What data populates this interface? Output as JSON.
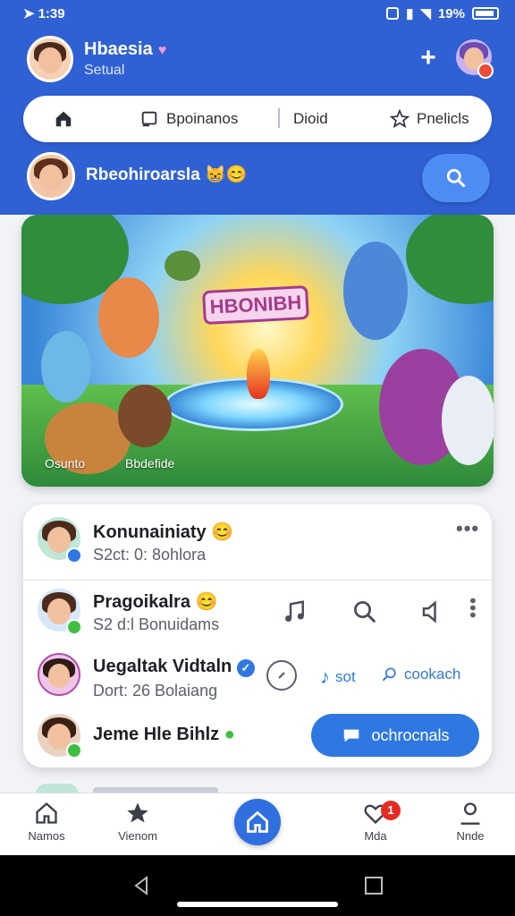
{
  "status_bar": {
    "time": "1:39",
    "battery": "19%"
  },
  "profile": {
    "name": "Hbaesia",
    "subtitle": "Setual"
  },
  "segments": [
    {
      "label": "",
      "icon": "home-icon"
    },
    {
      "label": "Bpoinanos",
      "icon": "square-icon"
    },
    {
      "label": "Dioid",
      "icon": ""
    },
    {
      "label": "Pnelicls",
      "icon": "star-icon"
    }
  ],
  "story": {
    "name": "Rbeohiroarsla"
  },
  "banner": {
    "title": "HBONIBH",
    "caption_left": "Osunto",
    "caption_right": "Bbdefide"
  },
  "feed": {
    "items": [
      {
        "title": "Konunainiaty",
        "subtitle": "S2ct: 0: 8ohlora",
        "badge_color": "#2f78e2"
      },
      {
        "title": "Pragoikalra",
        "subtitle": "S2 d:l Bonuidams",
        "badge_color": "#3fbf3f"
      },
      {
        "title": "Uegaltak Vidtaln",
        "subtitle": "Dort: 26 Bolaiang",
        "link_1": "sot",
        "link_2": "cookach"
      },
      {
        "title": "Jeme Hle Bihlz",
        "button_label": "ochrocnals",
        "badge_color": "#3fbf3f"
      }
    ]
  },
  "bottom_nav": [
    {
      "label": "Namos",
      "icon": "home-outline-icon"
    },
    {
      "label": "Vienom",
      "icon": "star-icon"
    },
    {
      "label": "",
      "icon": "home-icon"
    },
    {
      "label": "Mda",
      "icon": "heart-icon",
      "badge": "1"
    },
    {
      "label": "Nnde",
      "icon": "person-icon"
    }
  ],
  "colors": {
    "header": "#2f61d4",
    "accent": "#2f78e2",
    "badge": "#e52b24"
  }
}
